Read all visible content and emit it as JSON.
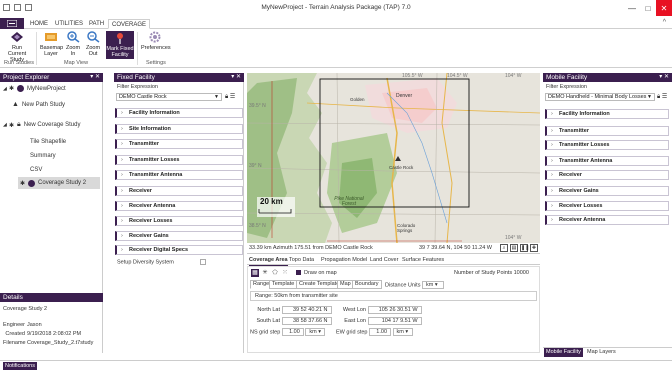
{
  "window": {
    "title": "MyNewProject - Terrain Analysis Package (TAP) 7.0",
    "minimize": "—",
    "maximize": "□",
    "close": "✕"
  },
  "ribbon": {
    "file_label": "",
    "tabs": [
      "HOME",
      "UTILITIES",
      "PATH",
      "COVERAGE"
    ],
    "active_tab": "COVERAGE",
    "buttons": {
      "run_current_study": "Run Current Study",
      "basemap_layer": "Basemap Layer",
      "zoom_in": "Zoom In",
      "zoom_out": "Zoom Out",
      "mark_fixed_facility": "Mark Fixed Facility",
      "preferences": "Preferences"
    },
    "groups": {
      "run_studies": "Run Studies",
      "map_view": "Map View",
      "settings": "Settings"
    }
  },
  "explorer": {
    "title": "Project Explorer",
    "pin": "▾ ✕",
    "project": "MyNewProject",
    "path_study": "New Path Study",
    "coverage_study": "New Coverage Study",
    "children": [
      "Tile Shapefile",
      "Summary",
      "CSV"
    ],
    "selected": "Coverage Study 2"
  },
  "details": {
    "title": "Details",
    "study_name": "Coverage Study 2",
    "engineer_label": "Engineer",
    "engineer": "Jason",
    "created_label": "Created",
    "created": "9/19/2018 2:08:02 PM",
    "filename_label": "Filename",
    "filename": "Coverage_Study_2.t7study"
  },
  "fixed_facility": {
    "title": "Fixed Facility",
    "pin": "▾ ✕",
    "filter_label": "Filter Expression",
    "selected": "DEMO Castle Rock",
    "sections": [
      "Facility Information",
      "Site Information",
      "Transmitter",
      "Transmitter Losses",
      "Transmitter Antenna",
      "Receiver",
      "Receiver Antenna",
      "Receiver Losses",
      "Receiver Gains",
      "Receiver Digital Specs"
    ],
    "diversity_label": "Setup Diversity System"
  },
  "map": {
    "labels": {
      "lon_top_1": "105.5° W",
      "lon_top_2": "104.5° W",
      "lon_top_3": "104° W",
      "lon_bottom": "104° W",
      "lat_1": "39.5° N",
      "lat_2": "39° N",
      "lat_3": "38.5° N",
      "city_denver": "Denver",
      "city_springs": "Colorado Springs",
      "city_golden": "Golden",
      "city_castle_rock": "Castle Rock",
      "forest": "Pike National Forest",
      "scale": "20 km"
    },
    "status_left": "33.39 km Azimuth 175.51 from DEMO Castle Rock",
    "status_right": "39 7 39.64 N, 104 50 11.24 W"
  },
  "coverage": {
    "tabs": [
      "Coverage Area",
      "Topo Data",
      "Propagation Model",
      "Land Cover",
      "Surface Features"
    ],
    "active_tab": "Coverage Area",
    "draw_on_map": "Draw on map",
    "study_points_label": "Number of Study Points",
    "study_points": "10000",
    "subtabs": [
      "Range",
      "Template",
      "Create Template",
      "Map",
      "Boundary"
    ],
    "distance_units_label": "Distance Units",
    "distance_units": "km",
    "range_note": "Range: 50km from transmitter site",
    "north_lat_label": "North Lat",
    "north_lat": "39 52 40.21 N",
    "west_lon_label": "West Lon",
    "west_lon": "105 26 30.51 W",
    "south_lat_label": "South Lat",
    "south_lat": "38 58 37.66 N",
    "east_lon_label": "East Lon",
    "east_lon": "104 17 9.51 W",
    "ns_grid_label": "NS grid step",
    "ns_grid": "1.00",
    "ns_unit": "km",
    "ew_grid_label": "EW grid step",
    "ew_grid": "1.00",
    "ew_unit": "km"
  },
  "mobile_facility": {
    "title": "Mobile Facility",
    "pin": "▾ ✕",
    "filter_label": "Filter Expression",
    "selected": "DEMO Handheld - Minimal Body Losses",
    "sections": [
      "Facility Information",
      "Transmitter",
      "Transmitter Losses",
      "Transmitter Antenna",
      "Receiver",
      "Receiver Gains",
      "Receiver Losses",
      "Receiver Antenna"
    ],
    "bottom_tabs": [
      "Mobile Facility",
      "Map Layers"
    ],
    "active_bottom_tab": "Mobile Facility"
  },
  "notifications": {
    "label": "Notifications"
  },
  "colors": {
    "brand": "#3b1f4f",
    "close": "#e81123",
    "map_red_line": "#c0392b"
  }
}
